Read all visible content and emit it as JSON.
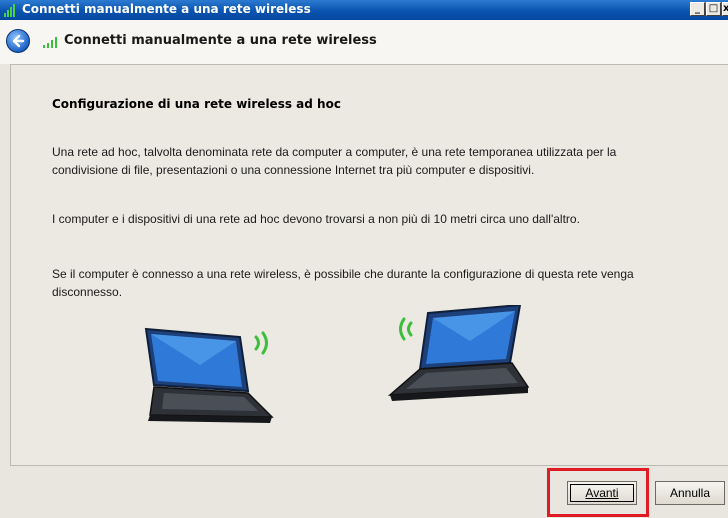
{
  "window": {
    "title": "Connetti manualmente a una rete wireless",
    "minimize_glyph": "_",
    "maximize_glyph": "□",
    "close_glyph": "x"
  },
  "nav": {
    "title": "Connetti manualmente a una rete wireless",
    "back_icon": "back-arrow-icon",
    "network_icon": "wireless-signal-icon"
  },
  "main": {
    "heading": "Configurazione di una rete wireless ad hoc",
    "paragraphs": [
      "Una rete ad hoc, talvolta denominata rete da computer a computer, è una rete temporanea utilizzata per la condivisione di file, presentazioni o una connessione Internet tra più computer e dispositivi.",
      "I computer e i dispositivi di una rete ad hoc devono trovarsi a non più di 10 metri circa uno dall'altro.",
      "Se il computer è connesso a una rete wireless, è possibile che durante la configurazione di questa rete venga disconnesso."
    ],
    "illustration": "two-laptops-wireless-illustration"
  },
  "footer": {
    "next_label": "Avanti",
    "cancel_label": "Annulla"
  },
  "colors": {
    "titlebar": "#0a54b0",
    "highlight": "#e01b24",
    "signal_green": "#3bbf3b"
  }
}
